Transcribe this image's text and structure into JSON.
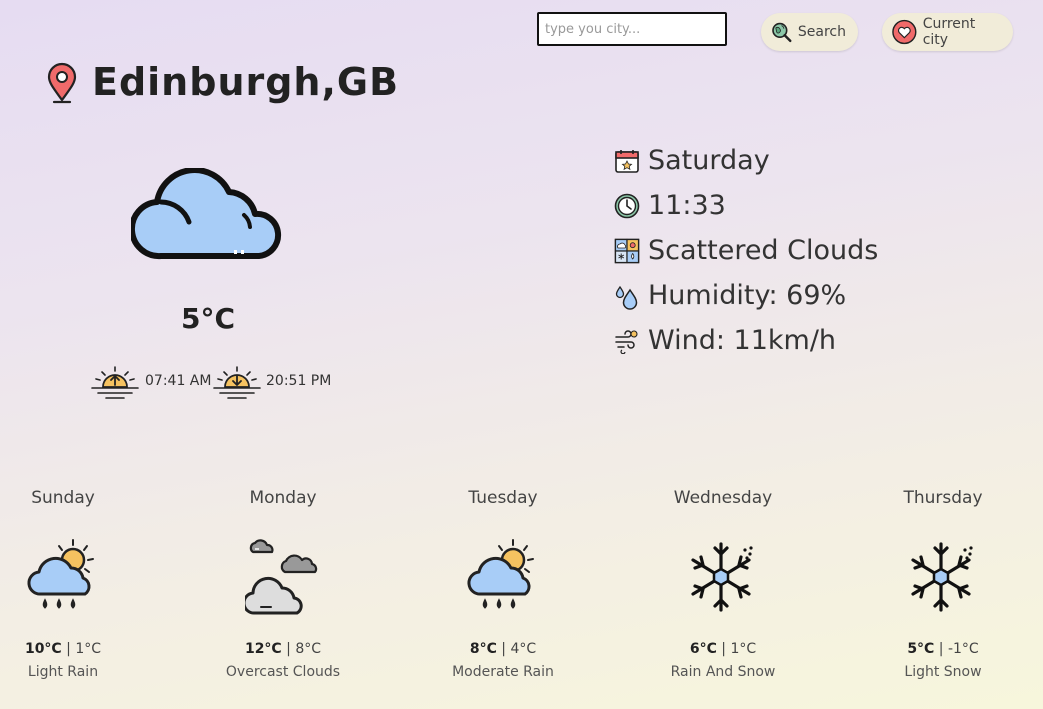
{
  "search": {
    "placeholder": "type you city...",
    "value": ""
  },
  "buttons": {
    "search_label": "Search",
    "current_label": "Current city"
  },
  "current": {
    "city": "Edinburgh,GB",
    "temperature": "5°C",
    "sunrise": "07:41 AM",
    "sunset": "20:51 PM",
    "icon": "cloud-icon"
  },
  "details": {
    "day": "Saturday",
    "time": "11:33",
    "condition": "Scattered Clouds",
    "humidity": "Humidity: 69%",
    "wind": "Wind: 11km/h"
  },
  "forecast": [
    {
      "day": "Sunday",
      "high": "10°C",
      "low": "1°C",
      "desc": "Light Rain",
      "icon": "sun-cloud-rain-icon"
    },
    {
      "day": "Monday",
      "high": "12°C",
      "low": "8°C",
      "desc": "Overcast Clouds",
      "icon": "overcast-clouds-icon"
    },
    {
      "day": "Tuesday",
      "high": "8°C",
      "low": "4°C",
      "desc": "Moderate Rain",
      "icon": "sun-cloud-rain-icon"
    },
    {
      "day": "Wednesday",
      "high": "6°C",
      "low": "1°C",
      "desc": "Rain And Snow",
      "icon": "snowflake-icon"
    },
    {
      "day": "Thursday",
      "high": "5°C",
      "low": "-1°C",
      "desc": "Light Snow",
      "icon": "snowflake-icon"
    }
  ],
  "colors": {
    "cloud_fill": "#a8cdf7",
    "sun_fill": "#f5c260",
    "pin_fill": "#f06a6a",
    "pill_bg": "#f1ecd9"
  }
}
